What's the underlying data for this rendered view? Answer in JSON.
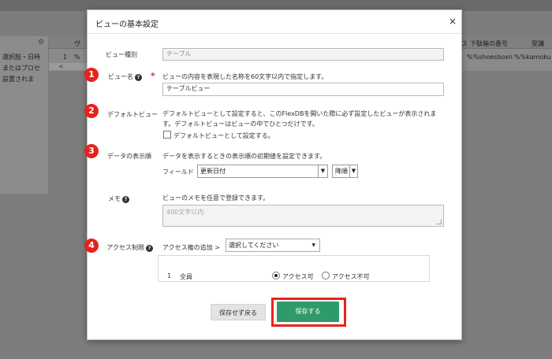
{
  "background": {
    "gear_icon": "gear-icon",
    "sidebar_lines": [
      "選択肢・日時",
      "またはプロセ",
      "設置されま"
    ],
    "table_cells": {
      "row_number": "1",
      "percent_fragment": "%",
      "col_fragment": "ヴ",
      "col_fragment2": "ス",
      "header_subject": "下駄箱の番号",
      "header_last": "受講",
      "value_1": "%%shoesboxn",
      "value_2": "%%kamoku"
    },
    "scroll_arrow": "<"
  },
  "modal": {
    "title": "ビューの基本設定",
    "close": "×",
    "badges": [
      "1",
      "2",
      "3",
      "4"
    ],
    "view_type": {
      "label": "ビュー種別",
      "value": "テーブル"
    },
    "view_name": {
      "label": "ビュー名",
      "help": "?",
      "required": "*",
      "description": "ビューの内容を表現した名称を60文字以内で指定します。",
      "value": "テーブルビュー"
    },
    "default_view": {
      "label": "デフォルトビュー",
      "description_1": "デフォルトビューとして設定すると、このFlexDBを開いた際に必ず設定したビューが表示されま",
      "description_2": "す。デフォルトビューはビューの中でひとつだけです。",
      "checkbox_label": "デフォルトビューとして設定する。",
      "checked": false
    },
    "display_order": {
      "label": "データの表示順",
      "description": "データを表示するときの表示順の初期値を設定できます。",
      "field_label": "フィールド",
      "field_value": "更新日付",
      "order_value": "降順"
    },
    "memo": {
      "label": "メモ",
      "help": "?",
      "description": "ビューのメモを任意で登録できます。",
      "placeholder": "400文字以内"
    },
    "access": {
      "label": "アクセス制限",
      "help": "?",
      "add_label": "アクセス権の追加 >",
      "select_value": "選択してください",
      "rows": [
        {
          "number": "1",
          "name": "全員",
          "allow_label": "アクセス可",
          "deny_label": "アクセス不可",
          "selected": "allow"
        }
      ]
    },
    "buttons": {
      "cancel": "保存せず戻る",
      "save": "保存する"
    },
    "highlight_color": "#e8231d",
    "save_color": "#2f9b6a",
    "badge_color": "#e4231b"
  }
}
